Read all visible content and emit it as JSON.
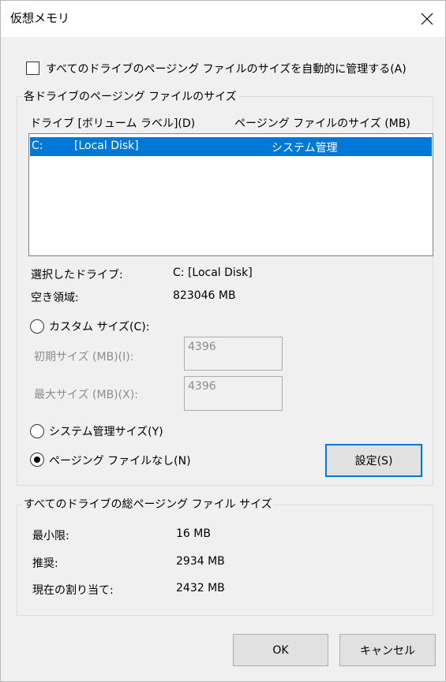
{
  "window": {
    "title": "仮想メモリ"
  },
  "auto_manage": {
    "label": "すべてのドライブのページング ファイルのサイズを自動的に管理する(A)",
    "checked": false
  },
  "drive_group": {
    "title": "各ドライブのページング ファイルのサイズ",
    "col_drive": "ドライブ  [ボリューム ラベル](D)",
    "col_size": "ページング ファイルのサイズ (MB)",
    "rows": [
      {
        "drive": "C:",
        "label": "[Local Disk]",
        "size": "システム管理"
      }
    ],
    "selected_drive_label": "選択したドライブ:",
    "selected_drive_value": "C:  [Local Disk]",
    "free_space_label": "空き領域:",
    "free_space_value": "823046 MB",
    "custom_size_label": "カスタム サイズ(C):",
    "initial_size_label": "初期サイズ (MB)(I):",
    "initial_size_value": "4396",
    "max_size_label": "最大サイズ (MB)(X):",
    "max_size_value": "4396",
    "system_managed_label": "システム管理サイズ(Y)",
    "no_paging_label": "ページング ファイルなし(N)",
    "selected_option": "no_paging",
    "set_button": "設定(S)"
  },
  "total_group": {
    "title": "すべてのドライブの総ページング ファイル サイズ",
    "min_label": "最小限:",
    "min_value": "16 MB",
    "recommended_label": "推奨:",
    "recommended_value": "2934 MB",
    "current_label": "現在の割り当て:",
    "current_value": "2432 MB"
  },
  "buttons": {
    "ok": "OK",
    "cancel": "キャンセル"
  },
  "colors": {
    "selection": "#0078d7",
    "focus_border": "#0078d7",
    "disabled_text": "#8c8c8c"
  },
  "icons": {
    "close": "close-icon"
  }
}
